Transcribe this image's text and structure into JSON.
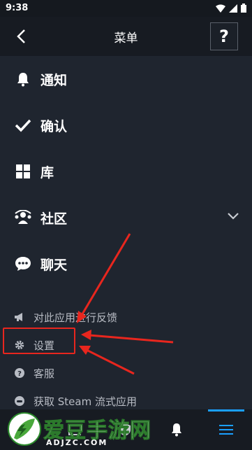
{
  "status_bar": {
    "time": "9:38"
  },
  "header": {
    "title": "菜单",
    "help_label": "?"
  },
  "menu": {
    "items": [
      {
        "label": "通知",
        "icon": "bell-icon"
      },
      {
        "label": "确认",
        "icon": "check-icon"
      },
      {
        "label": "库",
        "icon": "grid-icon"
      },
      {
        "label": "社区",
        "icon": "community-icon"
      },
      {
        "label": "聊天",
        "icon": "chat-icon"
      }
    ]
  },
  "submenu": {
    "items": [
      {
        "label": "对此应用进行反馈",
        "icon": "megaphone-icon"
      },
      {
        "label": "设置",
        "icon": "gear-icon"
      },
      {
        "label": "客服",
        "icon": "help-circle-icon"
      },
      {
        "label": "获取 Steam 流式应用",
        "icon": "controller-icon"
      }
    ]
  },
  "watermark": {
    "title": "爱豆手游网",
    "domain": "ADJZC.COM"
  },
  "colors": {
    "accent": "#1a9fff",
    "annotation": "#e8261e",
    "background": "#1f252f"
  }
}
